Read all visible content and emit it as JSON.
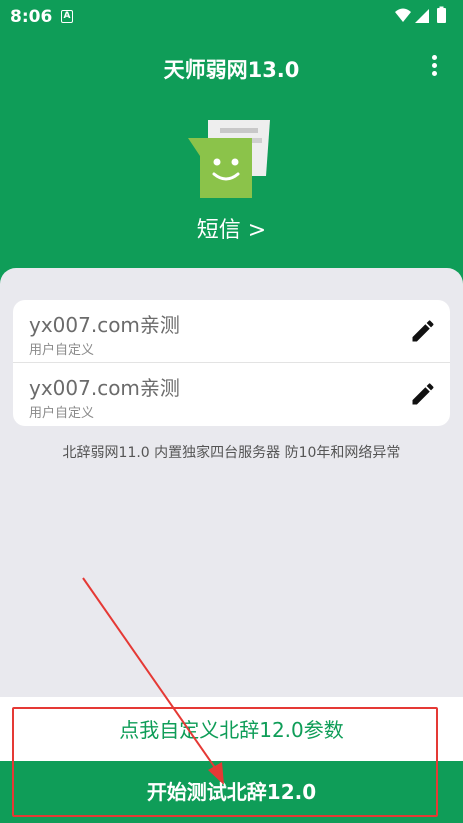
{
  "status_bar": {
    "time": "8:06",
    "notification_badge": "A",
    "icons": [
      "wifi-icon",
      "signal-icon",
      "battery-icon"
    ]
  },
  "app": {
    "title": "天师弱网13.0",
    "menu_icon": "more-vertical-icon"
  },
  "header": {
    "sms_icon": "sms-app-icon",
    "sms_label": "短信 >"
  },
  "config_list": [
    {
      "title": "yx007.com亲测",
      "subtitle": "用户自定义",
      "action_icon": "edit-icon"
    },
    {
      "title": "yx007.com亲测",
      "subtitle": "用户自定义",
      "action_icon": "edit-icon"
    }
  ],
  "info_text": "北辞弱网11.0 内置独家四台服务器 防10年和网络异常",
  "bottom": {
    "custom_params": "点我自定义北辞12.0参数",
    "start_button": "开始测试北辞12.0"
  },
  "colors": {
    "primary": "#0f9d58",
    "background": "#e9e9ee",
    "annotation": "#e53935"
  }
}
